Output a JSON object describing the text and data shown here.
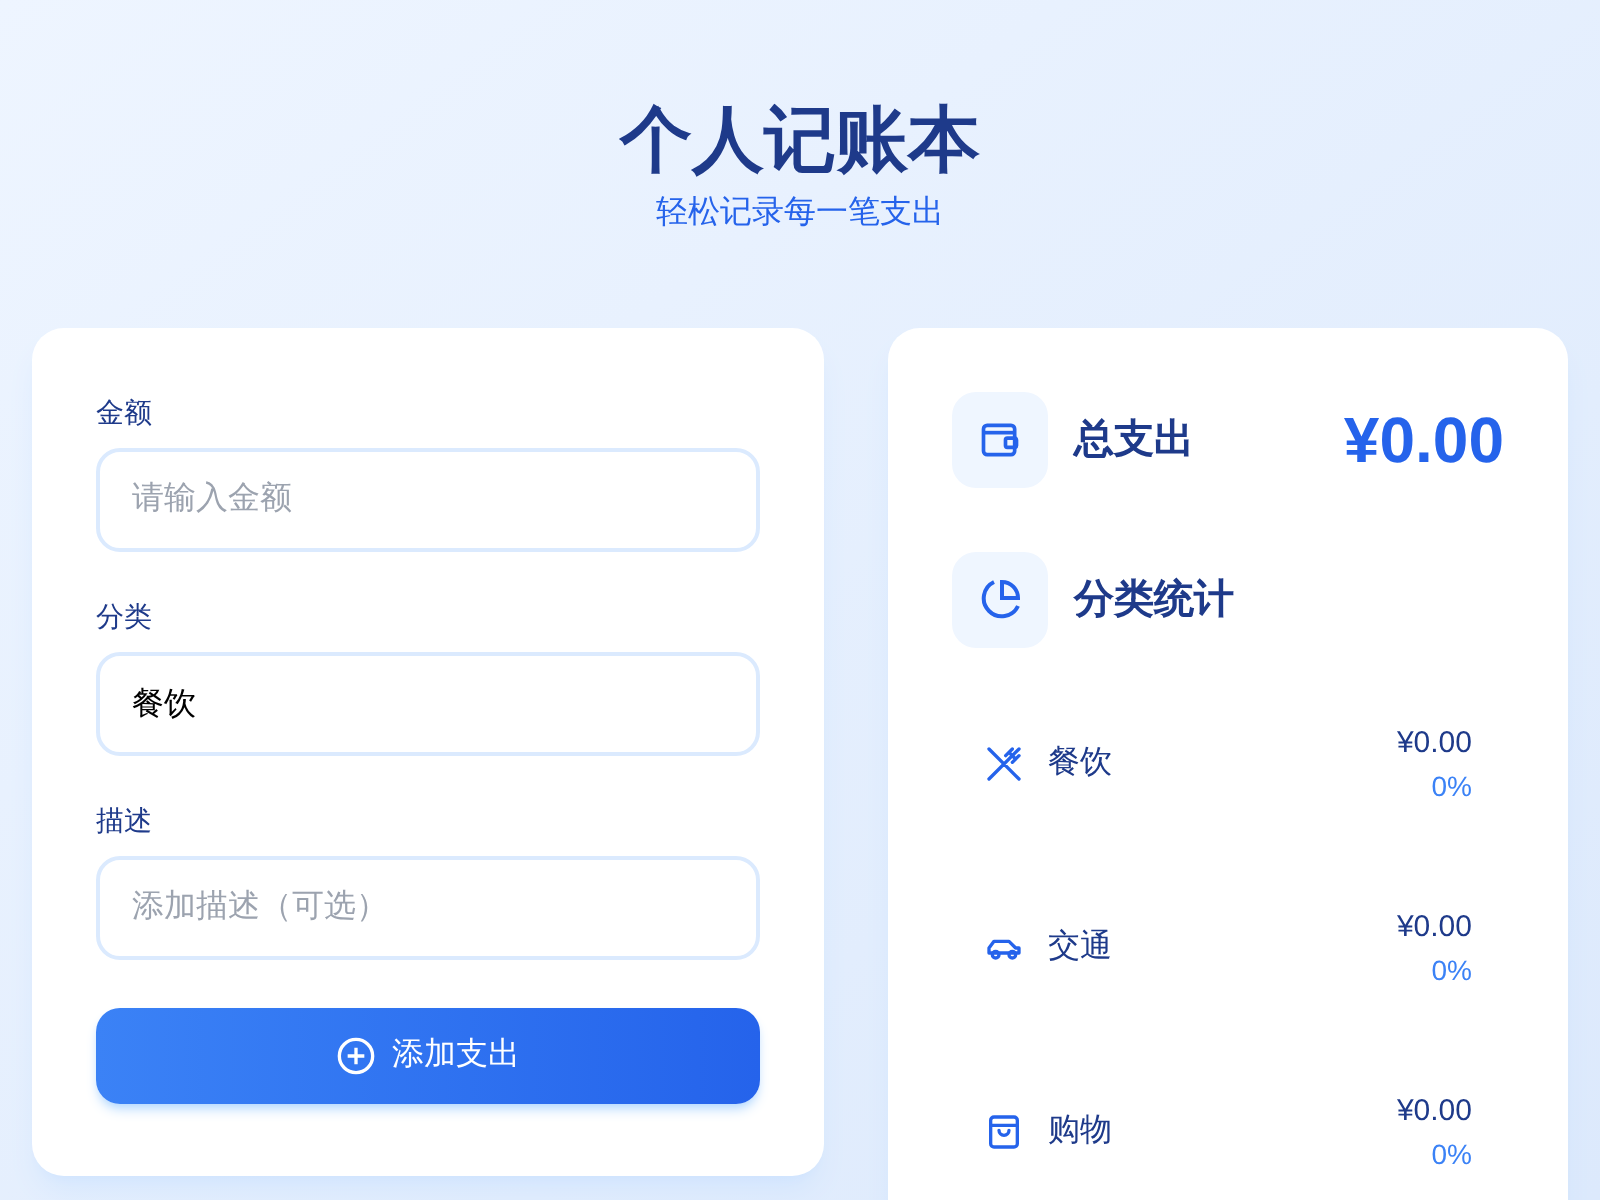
{
  "header": {
    "title": "个人记账本",
    "subtitle": "轻松记录每一笔支出"
  },
  "form": {
    "fields": [
      {
        "label": "金额",
        "placeholder": "请输入金额"
      },
      {
        "label": "分类",
        "value": "餐饮"
      },
      {
        "label": "描述",
        "placeholder": "添加描述（可选）"
      }
    ],
    "submit": "添加支出"
  },
  "summary": {
    "total_label": "总支出",
    "total": "¥0.00",
    "stats_label": "分类统计",
    "categories": [
      {
        "kind": "food",
        "name": "餐饮",
        "amount": "¥0.00",
        "percent": "0%"
      },
      {
        "kind": "transport",
        "name": "交通",
        "amount": "¥0.00",
        "percent": "0%"
      },
      {
        "kind": "shopping",
        "name": "购物",
        "amount": "¥0.00",
        "percent": "0%"
      }
    ]
  }
}
